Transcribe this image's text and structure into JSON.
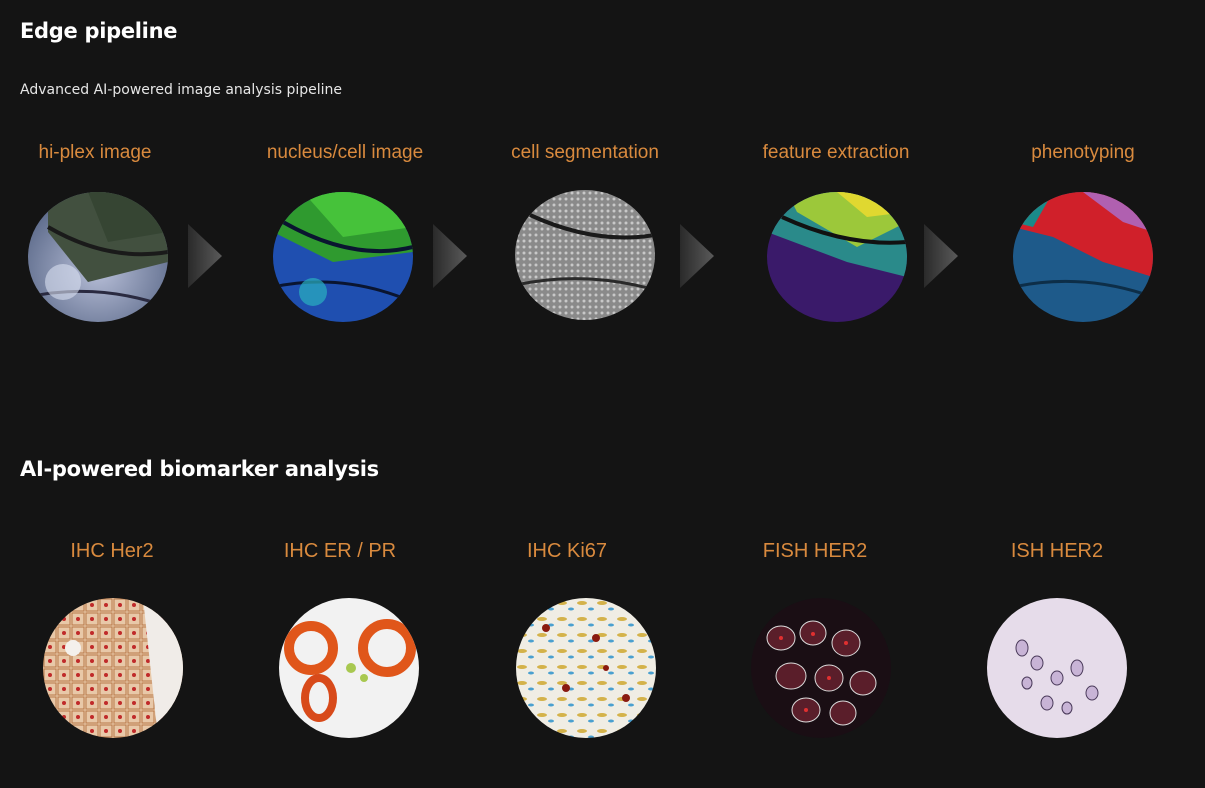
{
  "section_pipeline": {
    "title": "Edge pipeline",
    "subtitle": "Advanced AI-powered image analysis pipeline",
    "stages": [
      {
        "label": "hi-plex image",
        "icon": "hi-plex-image"
      },
      {
        "label": "nucleus/cell image",
        "icon": "nucleus-cell-image"
      },
      {
        "label": "cell segmentation",
        "icon": "cell-segmentation-image"
      },
      {
        "label": "feature extraction",
        "icon": "feature-extraction-image"
      },
      {
        "label": "phenotyping",
        "icon": "phenotyping-image"
      }
    ],
    "arrow_icon": "chevron-right-icon"
  },
  "section_biomarker": {
    "title": "AI-powered biomarker analysis",
    "items": [
      {
        "label": "IHC Her2",
        "icon": "ihc-her2-image"
      },
      {
        "label": "IHC ER / PR",
        "icon": "ihc-er-pr-image"
      },
      {
        "label": "IHC Ki67",
        "icon": "ihc-ki67-image"
      },
      {
        "label": "FISH HER2",
        "icon": "fish-her2-image"
      },
      {
        "label": "ISH HER2",
        "icon": "ish-her2-image"
      }
    ]
  },
  "colors": {
    "background": "#141414",
    "label_orange": "#d98a3e",
    "heading": "#ffffff"
  }
}
